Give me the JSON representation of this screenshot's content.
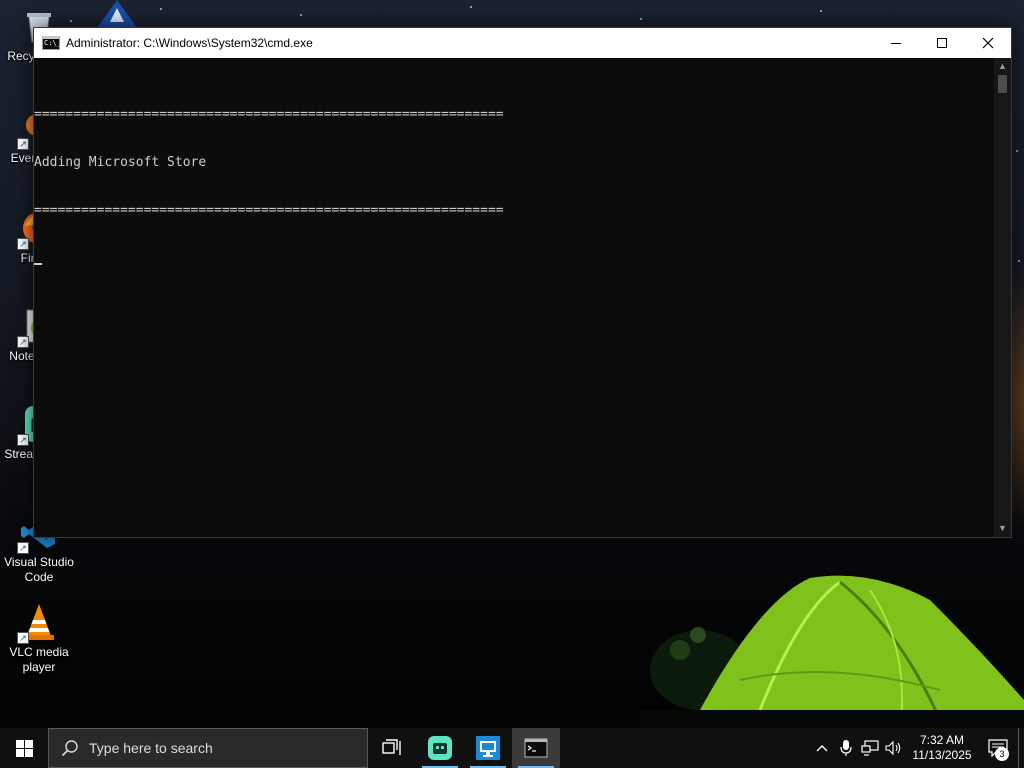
{
  "desktop": {
    "icons": [
      {
        "label": "Recycle Bin",
        "icon": "recycle-bin-icon"
      },
      {
        "label": "Everything",
        "icon": "everything-icon"
      },
      {
        "label": "Firefox",
        "icon": "firefox-icon"
      },
      {
        "label": "Notepad++",
        "icon": "notepad-plus-plus-icon"
      },
      {
        "label": "Stream Deck",
        "icon": "stream-deck-icon"
      },
      {
        "label": "Visual Studio Code",
        "icon": "vscode-icon"
      },
      {
        "label": "VLC media player",
        "icon": "vlc-icon"
      }
    ]
  },
  "window": {
    "title": "Administrator: C:\\Windows\\System32\\cmd.exe",
    "app_icon": "cmd-icon",
    "app_icon_text": "C:\\_",
    "output": [
      "============================================================",
      "Adding Microsoft Store",
      "============================================================"
    ]
  },
  "taskbar": {
    "search_placeholder": "Type here to search",
    "pinned": [
      {
        "name": "task-view",
        "icon": "task-view-icon"
      },
      {
        "name": "stream-deck",
        "icon": "stream-deck-icon"
      },
      {
        "name": "remote-desktop",
        "icon": "remote-desktop-icon"
      },
      {
        "name": "command-prompt",
        "icon": "cmd-icon"
      }
    ],
    "tray": {
      "time": "7:32 AM",
      "date": "11/13/2025",
      "notification_count": "3"
    }
  },
  "colors": {
    "console_bg": "#0c0c0c",
    "console_text": "#cccccc",
    "taskbar_bg": "#101010",
    "accent_underline": "#76b9ed"
  }
}
